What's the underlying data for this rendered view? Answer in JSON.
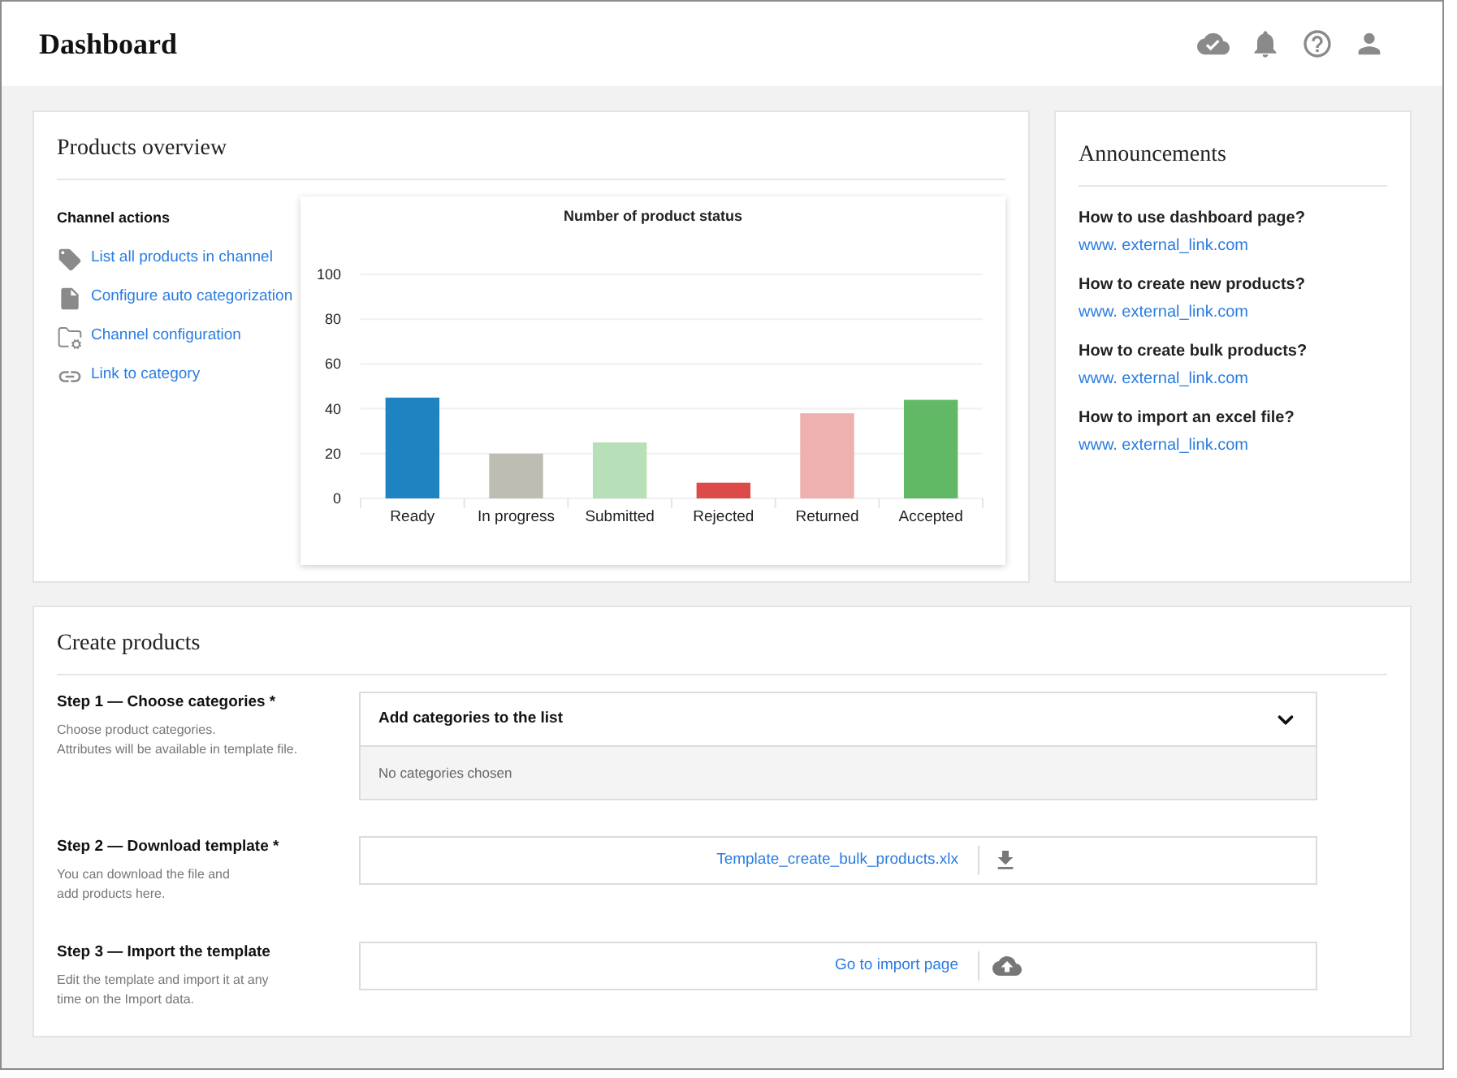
{
  "header": {
    "title": "Dashboard"
  },
  "products_overview": {
    "title": "Products overview",
    "channel_actions": {
      "title": "Channel actions",
      "items": [
        {
          "kind": "tag",
          "label": "List all products in channel"
        },
        {
          "kind": "file",
          "label": "Configure auto categorization"
        },
        {
          "kind": "folder",
          "label": "Channel configuration"
        },
        {
          "kind": "link",
          "label": "Link to category"
        }
      ]
    },
    "chart_data": {
      "type": "bar",
      "title": "Number of product status",
      "categories": [
        "Ready",
        "In progress",
        "Submitted",
        "Rejected",
        "Returned",
        "Accepted"
      ],
      "series": [
        {
          "color": "#1f83c2",
          "values": [
            45,
            null,
            null,
            null,
            null,
            null
          ]
        },
        {
          "color": "#bdbdb4",
          "values": [
            null,
            20,
            null,
            null,
            null,
            null
          ]
        },
        {
          "color": "#b8e0b8",
          "values": [
            null,
            null,
            25,
            null,
            null,
            null
          ]
        },
        {
          "color": "#dc4a4a",
          "values": [
            null,
            null,
            null,
            7,
            null,
            null
          ]
        },
        {
          "color": "#efb0b0",
          "values": [
            null,
            null,
            null,
            null,
            38,
            null
          ]
        },
        {
          "color": "#61b966",
          "values": [
            null,
            null,
            null,
            null,
            null,
            44
          ]
        }
      ],
      "stacked": true,
      "grid": true,
      "ylim": [
        0,
        100
      ],
      "yticks": [
        0,
        20,
        40,
        60,
        80,
        100
      ]
    }
  },
  "announcements": {
    "title": "Announcements",
    "items": [
      {
        "question": "How to use dashboard page?",
        "link": "www. external_link.com"
      },
      {
        "question": "How to create new products?",
        "link": "www. external_link.com"
      },
      {
        "question": "How to create bulk products?",
        "link": "www. external_link.com"
      },
      {
        "question": "How to import an excel file?",
        "link": "www. external_link.com"
      }
    ]
  },
  "create_products": {
    "title": "Create products",
    "steps": [
      {
        "kind": "dropdown",
        "title": "Step 1 — Choose categories *",
        "description": [
          "Choose product categories.",
          "Attributes will be available in template file."
        ],
        "control": {
          "label": "Add categories to the list",
          "expanded": true,
          "empty_text": "No categories chosen"
        }
      },
      {
        "kind": "download",
        "title": "Step 2 — Download template *",
        "description": [
          "You can download the file and",
          "add products here."
        ],
        "control": {
          "label": "Template_create_bulk_products.xlx"
        }
      },
      {
        "kind": "upload",
        "title": "Step 3 — Import the template",
        "description": [
          "Edit the template and import it at any",
          "time on the Import data."
        ],
        "control": {
          "label": "Go to import page"
        }
      }
    ]
  }
}
